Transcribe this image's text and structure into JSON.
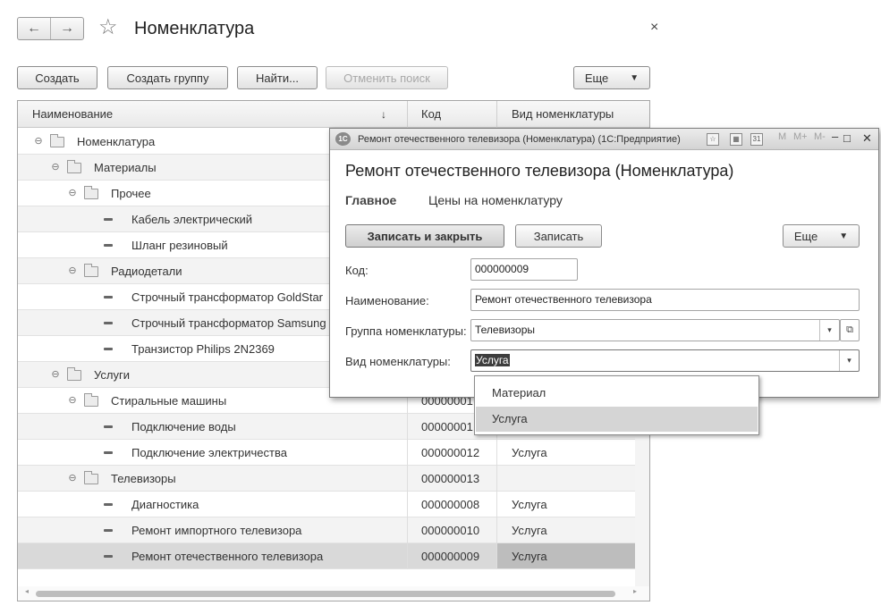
{
  "window": {
    "title": "Номенклатура",
    "back_glyph": "←",
    "forward_glyph": "→",
    "star_glyph": "☆",
    "close_glyph": "×"
  },
  "toolbar": {
    "create": "Создать",
    "create_group": "Создать группу",
    "find": "Найти...",
    "cancel_search": "Отменить поиск",
    "more": "Еще",
    "more_caret": "▼"
  },
  "table": {
    "columns": {
      "name": "Наименование",
      "sort_indicator": "↓",
      "code": "Код",
      "kind": "Вид номенклатуры"
    },
    "rows": [
      {
        "name": "Номенклатура",
        "type": "group",
        "level": 0,
        "code": "",
        "kind": ""
      },
      {
        "name": "Материалы",
        "type": "group",
        "level": 1,
        "code": "",
        "kind": ""
      },
      {
        "name": "Прочее",
        "type": "group",
        "level": 2,
        "code": "",
        "kind": ""
      },
      {
        "name": "Кабель электрический",
        "type": "item",
        "level": 3,
        "code": "",
        "kind": ""
      },
      {
        "name": "Шланг резиновый",
        "type": "item",
        "level": 3,
        "code": "",
        "kind": ""
      },
      {
        "name": "Радиодетали",
        "type": "group",
        "level": 2,
        "code": "",
        "kind": ""
      },
      {
        "name": "Строчный трансформатор GoldStar",
        "type": "item",
        "level": 3,
        "code": "",
        "kind": ""
      },
      {
        "name": "Строчный трансформатор Samsung",
        "type": "item",
        "level": 3,
        "code": "",
        "kind": ""
      },
      {
        "name": "Транзистор Philips 2N2369",
        "type": "item",
        "level": 3,
        "code": "",
        "kind": ""
      },
      {
        "name": "Услуги",
        "type": "group",
        "level": 1,
        "code": "",
        "kind": ""
      },
      {
        "name": "Стиральные машины",
        "type": "group",
        "level": 2,
        "code": "00000001",
        "kind": ""
      },
      {
        "name": "Подключение воды",
        "type": "item",
        "level": 3,
        "code": "00000001",
        "kind": ""
      },
      {
        "name": "Подключение электричества",
        "type": "item",
        "level": 3,
        "code": "000000012",
        "kind": "Услуга"
      },
      {
        "name": "Телевизоры",
        "type": "group",
        "level": 2,
        "code": "000000013",
        "kind": ""
      },
      {
        "name": "Диагностика",
        "type": "item",
        "level": 3,
        "code": "000000008",
        "kind": "Услуга"
      },
      {
        "name": "Ремонт импортного телевизора",
        "type": "item",
        "level": 3,
        "code": "000000010",
        "kind": "Услуга"
      },
      {
        "name": "Ремонт отечественного телевизора",
        "type": "item",
        "level": 3,
        "code": "000000009",
        "kind": "Услуга",
        "selected": true
      }
    ]
  },
  "dialog": {
    "window_title": "Ремонт отечественного телевизора (Номенклатура)  (1С:Предприятие)",
    "logo": "1С",
    "tb_m": "M",
    "tb_mplus": "M+",
    "tb_mminus": "M-",
    "tb_min": "▭",
    "tb_max": "□",
    "tb_close": "✕",
    "heading": "Ремонт отечественного телевизора (Номенклатура)",
    "tabs": [
      "Главное",
      "Цены на номенклатуру"
    ],
    "save_close": "Записать и закрыть",
    "save": "Записать",
    "more": "Еще",
    "more_caret": "▼",
    "labels": {
      "code": "Код:",
      "name": "Наименование:",
      "group": "Группа номенклатуры:",
      "kind": "Вид номенклатуры:"
    },
    "values": {
      "code": "000000009",
      "name": "Ремонт отечественного телевизора",
      "group": "Телевизоры",
      "kind": "Услуга"
    },
    "dropdown_caret": "▾",
    "open_glyph": "⧉"
  },
  "popup": {
    "options": [
      "Материал",
      "Услуга"
    ],
    "highlighted": "Услуга"
  }
}
